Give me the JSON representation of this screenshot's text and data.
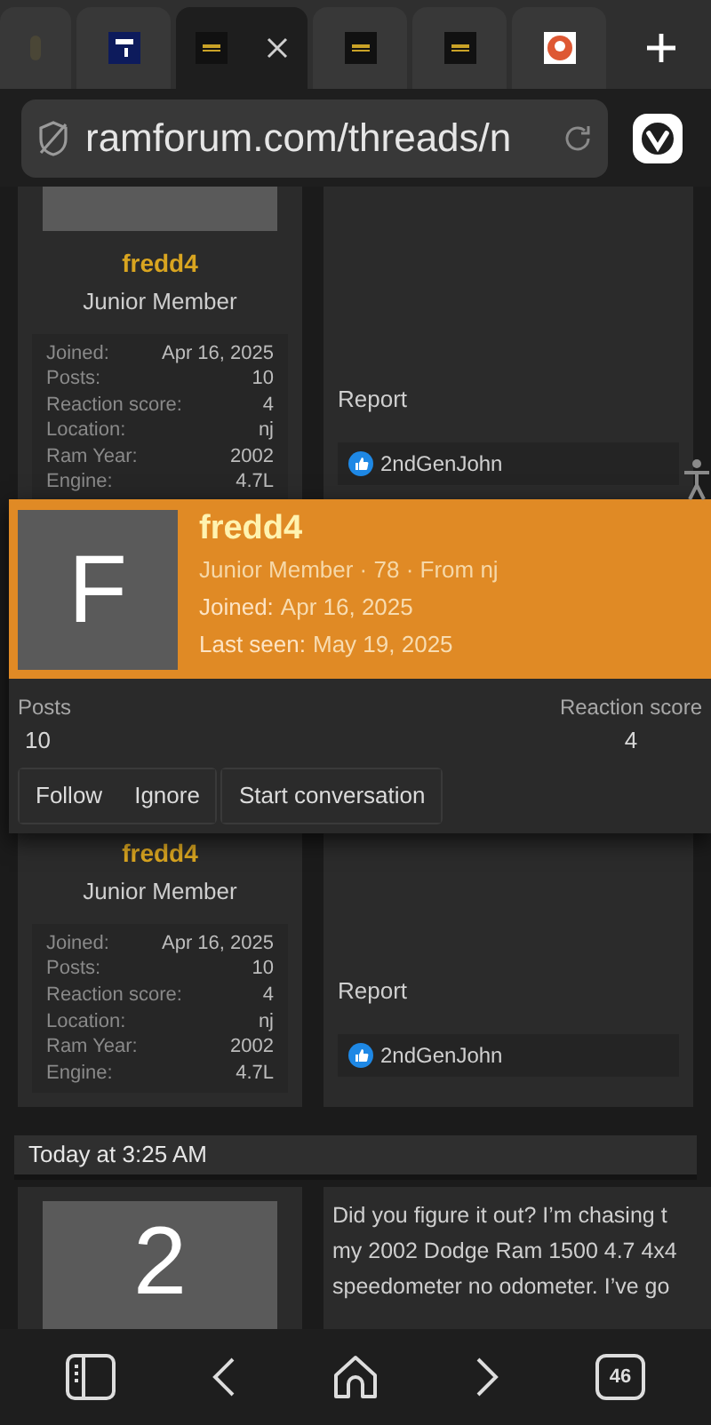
{
  "tabs": [
    {
      "kind": "faded",
      "selected": false
    },
    {
      "kind": "m-logo",
      "selected": false
    },
    {
      "kind": "forum-logo",
      "selected": true
    },
    {
      "kind": "forum-logo",
      "selected": false
    },
    {
      "kind": "forum-logo",
      "selected": false
    },
    {
      "kind": "duck-logo",
      "selected": false
    }
  ],
  "address_bar": {
    "url": "ramforum.com/threads/n"
  },
  "post_top": {
    "name": "fredd4",
    "title": "Junior Member",
    "stats": [
      {
        "label": "Joined:",
        "value": "Apr 16, 2025"
      },
      {
        "label": "Posts:",
        "value": "10"
      },
      {
        "label": "Reaction score:",
        "value": "4"
      },
      {
        "label": "Location:",
        "value": "nj"
      },
      {
        "label": "Ram Year:",
        "value": "2002"
      },
      {
        "label": "Engine:",
        "value": "4.7L"
      }
    ],
    "action": "Report",
    "reaction_user": "2ndGenJohn"
  },
  "popup": {
    "avatar_letter": "F",
    "name": "fredd4",
    "subtitle": "Junior Member · 78 · From nj",
    "joined_label": "Joined:",
    "joined": "Apr 16, 2025",
    "last_seen_label": "Last seen:",
    "last_seen": "May 19, 2025",
    "stats": [
      {
        "label": "Posts",
        "value": "10"
      },
      {
        "label": "Reaction score",
        "value": "4"
      }
    ],
    "buttons": [
      {
        "label": "Follow",
        "kind": "joined"
      },
      {
        "label": "Ignore",
        "kind": "joined"
      },
      {
        "label": "Start conversation",
        "kind": "separate"
      }
    ]
  },
  "post_middle": {
    "name": "fredd4",
    "title": "Junior Member",
    "stats": [
      {
        "label": "Joined:",
        "value": "Apr 16, 2025"
      },
      {
        "label": "Posts:",
        "value": "10"
      },
      {
        "label": "Reaction score:",
        "value": "4"
      },
      {
        "label": "Location:",
        "value": "nj"
      },
      {
        "label": "Ram Year:",
        "value": "2002"
      },
      {
        "label": "Engine:",
        "value": "4.7L"
      }
    ],
    "action": "Report",
    "reaction_user": "2ndGenJohn"
  },
  "post_bottom": {
    "date": "Today at 3:25 AM",
    "avatar_letter": "2",
    "lines": [
      "Did you figure it out? I’m chasing t",
      "my 2002 Dodge Ram 1500 4.7 4x4",
      "speedometer no odometer. I’ve go"
    ]
  },
  "bottom_nav": {
    "tab_count": "46"
  }
}
